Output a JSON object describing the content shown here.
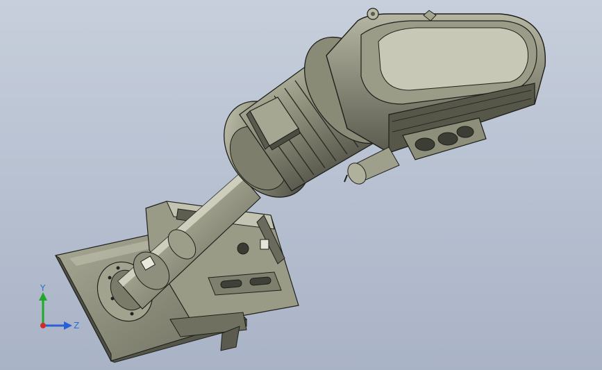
{
  "viewport": {
    "background_top": "#c7cfdc",
    "background_bottom": "#a9b3c6"
  },
  "model": {
    "body_color": "#8f907c",
    "body_light": "#b9baa6",
    "body_dark": "#4a4b40",
    "edge_color": "#1e1f1a"
  },
  "triad": {
    "y_label": "Y",
    "z_label": "Z",
    "y_color": "#1fa82a",
    "z_color": "#2a5fd8",
    "x_color": "#d02a2a"
  }
}
